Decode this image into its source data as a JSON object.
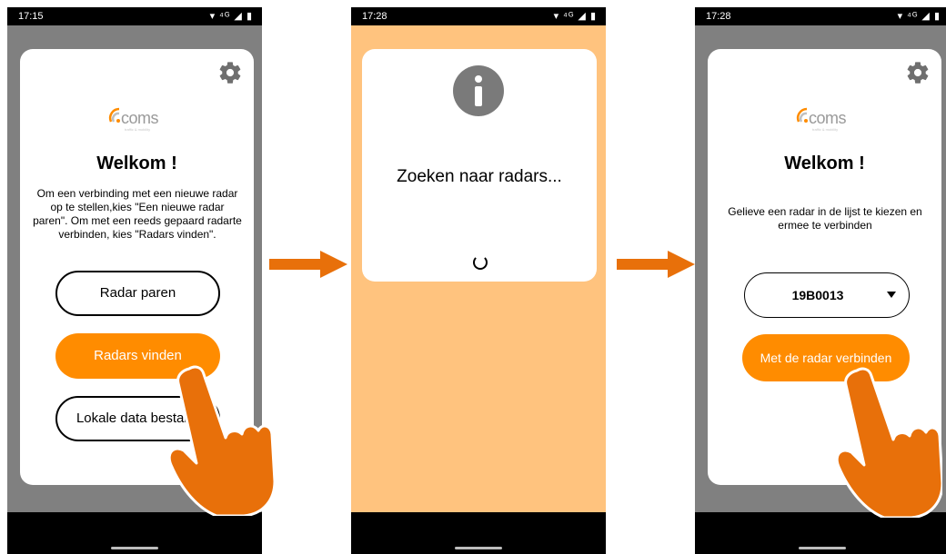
{
  "screens": [
    {
      "status_time": "17:15",
      "status_icons": "▾ ⁴ᴳ ◢ ▮",
      "logo_text": "coms",
      "logo_subtext": "traffic & mobility",
      "title": "Welkom !",
      "description": "Om een verbinding met een nieuwe radar op te stellen,kies \"Een nieuwe radar paren\".  Om met een reeds gepaard radarte verbinden, kies \"Radars vinden\".",
      "buttons": {
        "pair": "Radar paren",
        "find": "Radars vinden",
        "local": "Lokale data bestand"
      }
    },
    {
      "status_time": "17:28",
      "status_icons": "▾ ⁴ᴳ ◢ ▮",
      "searching_text": "Zoeken naar radars..."
    },
    {
      "status_time": "17:28",
      "status_icons": "▾ ⁴ᴳ ◢ ▮",
      "logo_text": "coms",
      "logo_subtext": "traffic & mobility",
      "title": "Welkom !",
      "description": "Gelieve een radar in de lijst te kiezen en ermee te verbinden",
      "select_value": "19B0013",
      "connect_button": "Met de radar verbinden"
    }
  ],
  "colors": {
    "accent": "#ff8c00",
    "hand": "#e8700a",
    "screen_bg_gray": "#808080",
    "screen_bg_orange": "#ffc37e"
  },
  "icons": [
    "gear-icon",
    "info-icon",
    "loading-spinner-icon",
    "dropdown-caret-icon",
    "arrow-right-icon",
    "pointing-hand-icon"
  ]
}
